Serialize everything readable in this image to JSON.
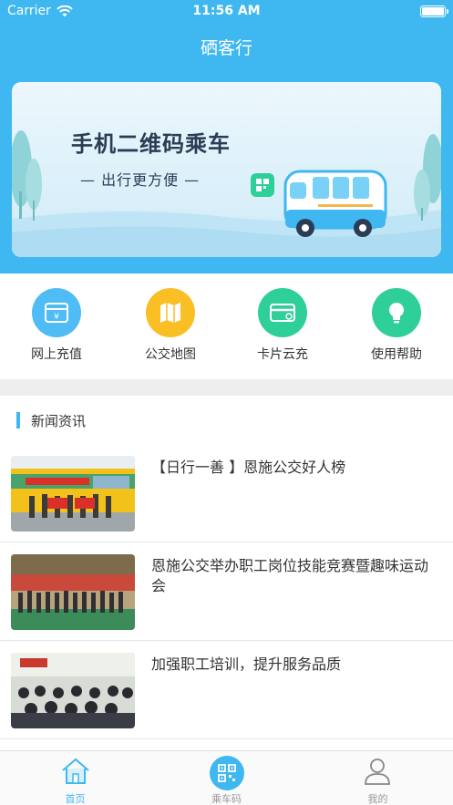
{
  "status_bar": {
    "carrier": "Carrier",
    "time": "11:56 AM"
  },
  "app": {
    "title": "硒客行"
  },
  "banner": {
    "title": "手机二维码乘车",
    "subtitle": "— 出行更方便 —"
  },
  "quick_menu": [
    {
      "label": "网上充值",
      "icon": "wallet-icon",
      "color": "#4fbcf5"
    },
    {
      "label": "公交地图",
      "icon": "map-icon",
      "color": "#fbbf26"
    },
    {
      "label": "卡片云充",
      "icon": "card-icon",
      "color": "#2fcf9a"
    },
    {
      "label": "使用帮助",
      "icon": "lightbulb-icon",
      "color": "#2fcf9a"
    }
  ],
  "news": {
    "title": "新闻资讯",
    "items": [
      {
        "title": "【日行一善 】恩施公交好人榜"
      },
      {
        "title": "恩施公交举办职工岗位技能竞赛暨趣味运动会"
      },
      {
        "title": "加强职工培训，提升服务品质"
      }
    ]
  },
  "tabbar": {
    "items": [
      {
        "label": "首页",
        "icon": "home-icon",
        "active": true
      },
      {
        "label": "乘车码",
        "icon": "qr-code-icon",
        "active": false
      },
      {
        "label": "我的",
        "icon": "user-icon",
        "active": false
      }
    ]
  },
  "colors": {
    "primary": "#3fb7f0",
    "background": "#eeeeee",
    "text": "#333333"
  }
}
